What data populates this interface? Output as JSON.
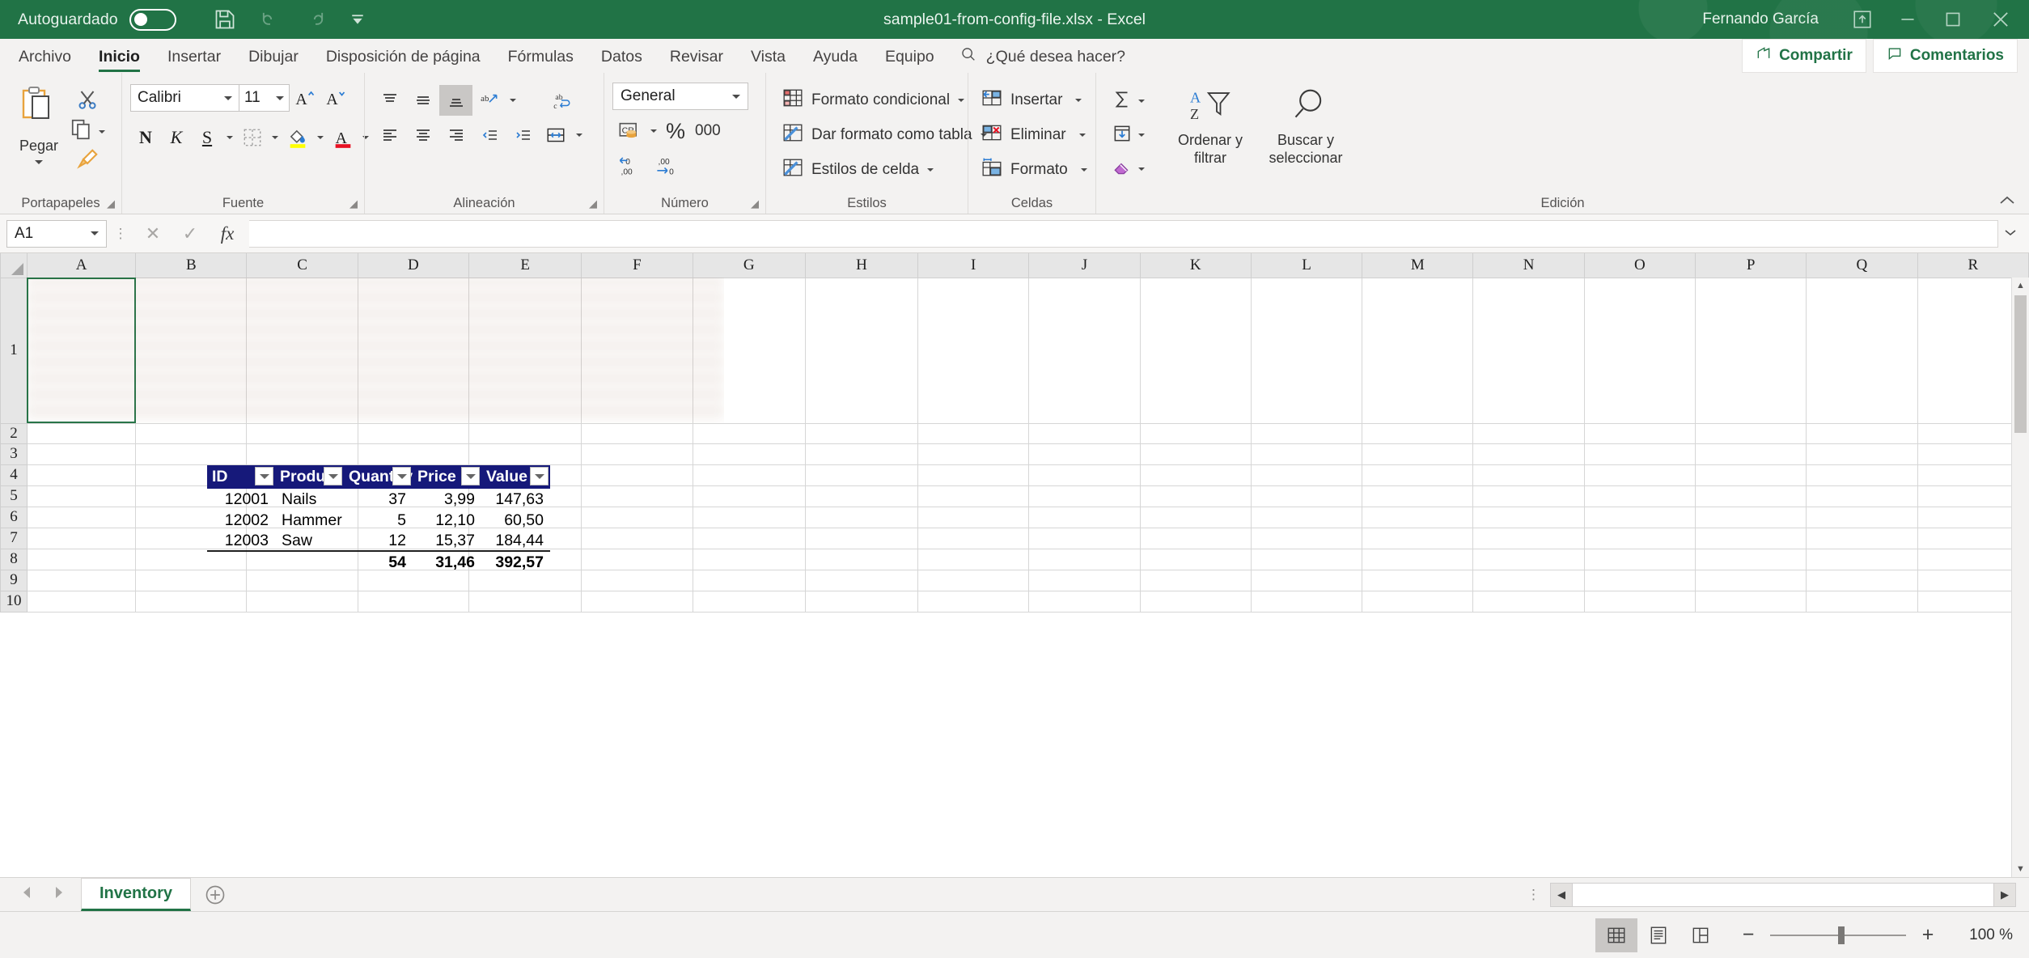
{
  "titlebar": {
    "autosave_label": "Autoguardado",
    "autosave_state": "off",
    "document_title": "sample01-from-config-file.xlsx  -  Excel",
    "username": "Fernando García",
    "quick_access": [
      "save-icon",
      "undo-icon",
      "redo-icon",
      "customize-qat-icon"
    ],
    "window_buttons": [
      "ribbon-display-options-icon",
      "minimize-icon",
      "maximize-icon",
      "close-icon"
    ]
  },
  "tabs": [
    {
      "label": "Archivo",
      "active": false
    },
    {
      "label": "Inicio",
      "active": true
    },
    {
      "label": "Insertar",
      "active": false
    },
    {
      "label": "Dibujar",
      "active": false
    },
    {
      "label": "Disposición de página",
      "active": false
    },
    {
      "label": "Fórmulas",
      "active": false
    },
    {
      "label": "Datos",
      "active": false
    },
    {
      "label": "Revisar",
      "active": false
    },
    {
      "label": "Vista",
      "active": false
    },
    {
      "label": "Ayuda",
      "active": false
    },
    {
      "label": "Equipo",
      "active": false
    }
  ],
  "tellme": {
    "placeholder": "¿Qué desea hacer?"
  },
  "share": {
    "share_label": "Compartir",
    "comments_label": "Comentarios"
  },
  "ribbon": {
    "clipboard": {
      "group_label": "Portapapeles",
      "paste_label": "Pegar",
      "cut_label": "cut-icon",
      "copy_label": "copy-icon",
      "format_painter_label": "format-painter-icon"
    },
    "font": {
      "group_label": "Fuente",
      "font_name": "Calibri",
      "font_size": "11",
      "grow_label": "A",
      "shrink_label": "A",
      "bold_label": "N",
      "italic_label": "K",
      "underline_label": "S"
    },
    "alignment": {
      "group_label": "Alineación"
    },
    "number": {
      "group_label": "Número",
      "format": "General",
      "percent_label": "%",
      "thousands_label": "000"
    },
    "styles": {
      "group_label": "Estilos",
      "items": [
        "Formato condicional",
        "Dar formato como tabla",
        "Estilos de celda"
      ]
    },
    "cells": {
      "group_label": "Celdas",
      "items": [
        "Insertar",
        "Eliminar",
        "Formato"
      ]
    },
    "editing": {
      "group_label": "Edición",
      "sort_label": "Ordenar y filtrar",
      "find_label": "Buscar y seleccionar"
    }
  },
  "formula_bar": {
    "name_box": "A1",
    "formula_value": "",
    "cancel_icon": "cancel-icon",
    "confirm_icon": "confirm-icon",
    "fx_icon": "fx"
  },
  "grid": {
    "columns": [
      "A",
      "B",
      "C",
      "D",
      "E",
      "F",
      "G",
      "H",
      "I",
      "J",
      "K",
      "L",
      "M",
      "N",
      "O",
      "P",
      "Q",
      "R"
    ],
    "rows": [
      "1",
      "2",
      "3",
      "4",
      "5",
      "6",
      "7",
      "8",
      "9",
      "10"
    ],
    "selected_cell": "A1"
  },
  "table": {
    "headers": [
      "ID",
      "Product",
      "Quantity",
      "Price",
      "Value"
    ],
    "rows": [
      {
        "id": "12001",
        "product": "Nails",
        "quantity": "37",
        "price": "3,99",
        "value": "147,63"
      },
      {
        "id": "12002",
        "product": "Hammer",
        "quantity": "5",
        "price": "12,10",
        "value": "60,50"
      },
      {
        "id": "12003",
        "product": "Saw",
        "quantity": "12",
        "price": "15,37",
        "value": "184,44"
      }
    ],
    "totals": {
      "id": "",
      "product": "",
      "quantity": "54",
      "price": "31,46",
      "value": "392,57"
    },
    "header_bg": "#16197a",
    "header_color": "#ffffff"
  },
  "sheet_tabs": {
    "tabs": [
      {
        "label": "Inventory",
        "active": true
      }
    ],
    "add_label": "+"
  },
  "status_bar": {
    "views": [
      "normal-view-icon",
      "page-layout-icon",
      "page-break-preview-icon"
    ],
    "active_view": "normal-view-icon",
    "zoom_minus": "−",
    "zoom_plus": "+",
    "zoom_level": "100 %"
  }
}
